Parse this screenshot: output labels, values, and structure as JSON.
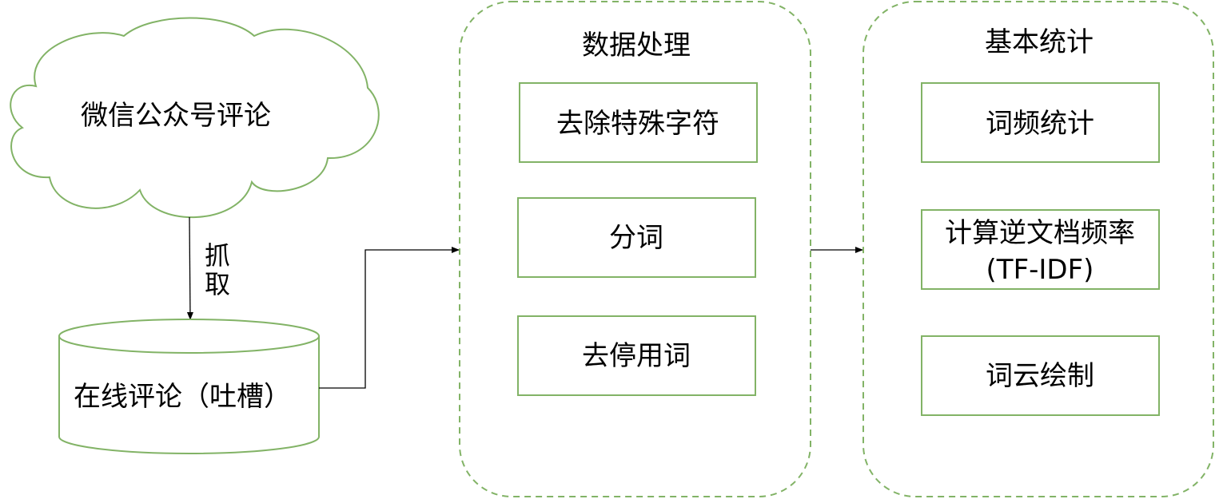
{
  "source": {
    "label": "微信公众号评论"
  },
  "fetch_edge": {
    "label_lines": [
      "抓",
      "取"
    ]
  },
  "storage": {
    "label": "在线评论（吐槽）"
  },
  "processing": {
    "title": "数据处理",
    "steps": [
      {
        "lines": [
          "去除特殊字符"
        ]
      },
      {
        "lines": [
          "分词"
        ]
      },
      {
        "lines": [
          "去停用词"
        ]
      }
    ]
  },
  "statistics": {
    "title": "基本统计",
    "steps": [
      {
        "lines": [
          "词频统计"
        ]
      },
      {
        "lines": [
          "计算逆文档频率",
          "(TF-IDF)"
        ]
      },
      {
        "lines": [
          "词云绘制"
        ]
      }
    ]
  },
  "colors": {
    "node_stroke": "#82b366",
    "edge": "#000000",
    "text": "#000000"
  }
}
